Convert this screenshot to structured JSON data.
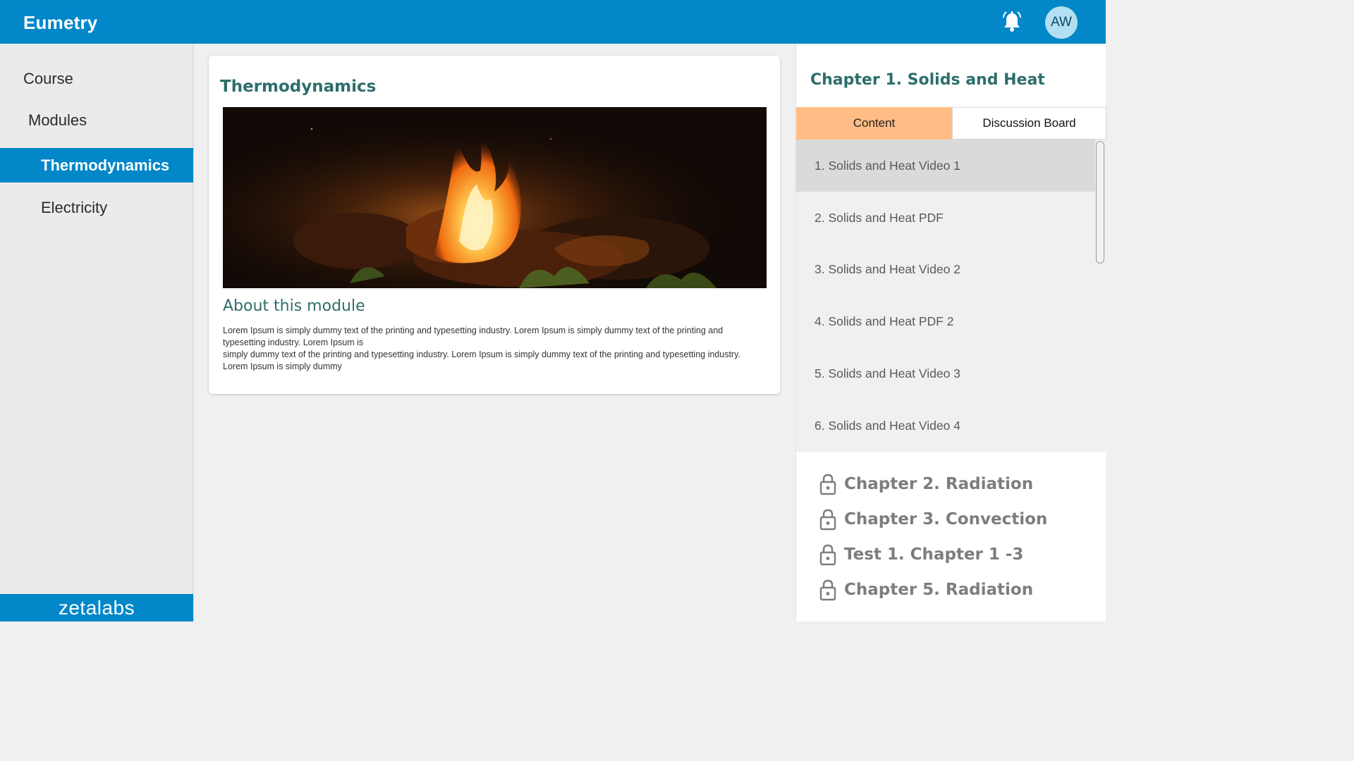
{
  "header": {
    "brand": "Eumetry",
    "avatar_initials": "AW",
    "icons": [
      "bell-icon"
    ]
  },
  "sidebar": {
    "course_label": "Course",
    "modules_label": "Modules",
    "items": [
      {
        "label": "Thermodynamics",
        "active": true
      },
      {
        "label": "Electricity",
        "active": false
      }
    ],
    "footer_logo": "zetalabs"
  },
  "module": {
    "title": "Thermodynamics",
    "about_heading": "About this module",
    "description_lines": [
      "Lorem Ipsum is simply dummy text of the printing and typesetting industry. Lorem Ipsum is simply dummy text of the printing and typesetting industry. Lorem Ipsum is",
      "simply dummy text of the printing and typesetting industry.  Lorem Ipsum is simply dummy text of the printing and typesetting industry. Lorem Ipsum is simply dummy"
    ]
  },
  "chapter_panel": {
    "title": "Chapter 1. Solids and Heat",
    "tabs": [
      "Content",
      "Discussion Board"
    ],
    "active_tab": "Content",
    "lessons": [
      "1. Solids and Heat Video 1",
      "2. Solids and Heat PDF",
      "3. Solids and Heat Video 2",
      "4. Solids and Heat PDF 2",
      "5. Solids and Heat Video 3",
      "6. Solids and Heat Video 4"
    ],
    "selected_lesson_index": 0,
    "locked_chapters": [
      "Chapter 2. Radiation",
      "Chapter 3. Convection",
      "Test 1. Chapter 1 -3",
      "Chapter 5. Radiation"
    ]
  },
  "colors": {
    "brand_blue": "#0287c9",
    "teal_heading": "#2e6e6b",
    "active_tab": "#ffbd85"
  }
}
